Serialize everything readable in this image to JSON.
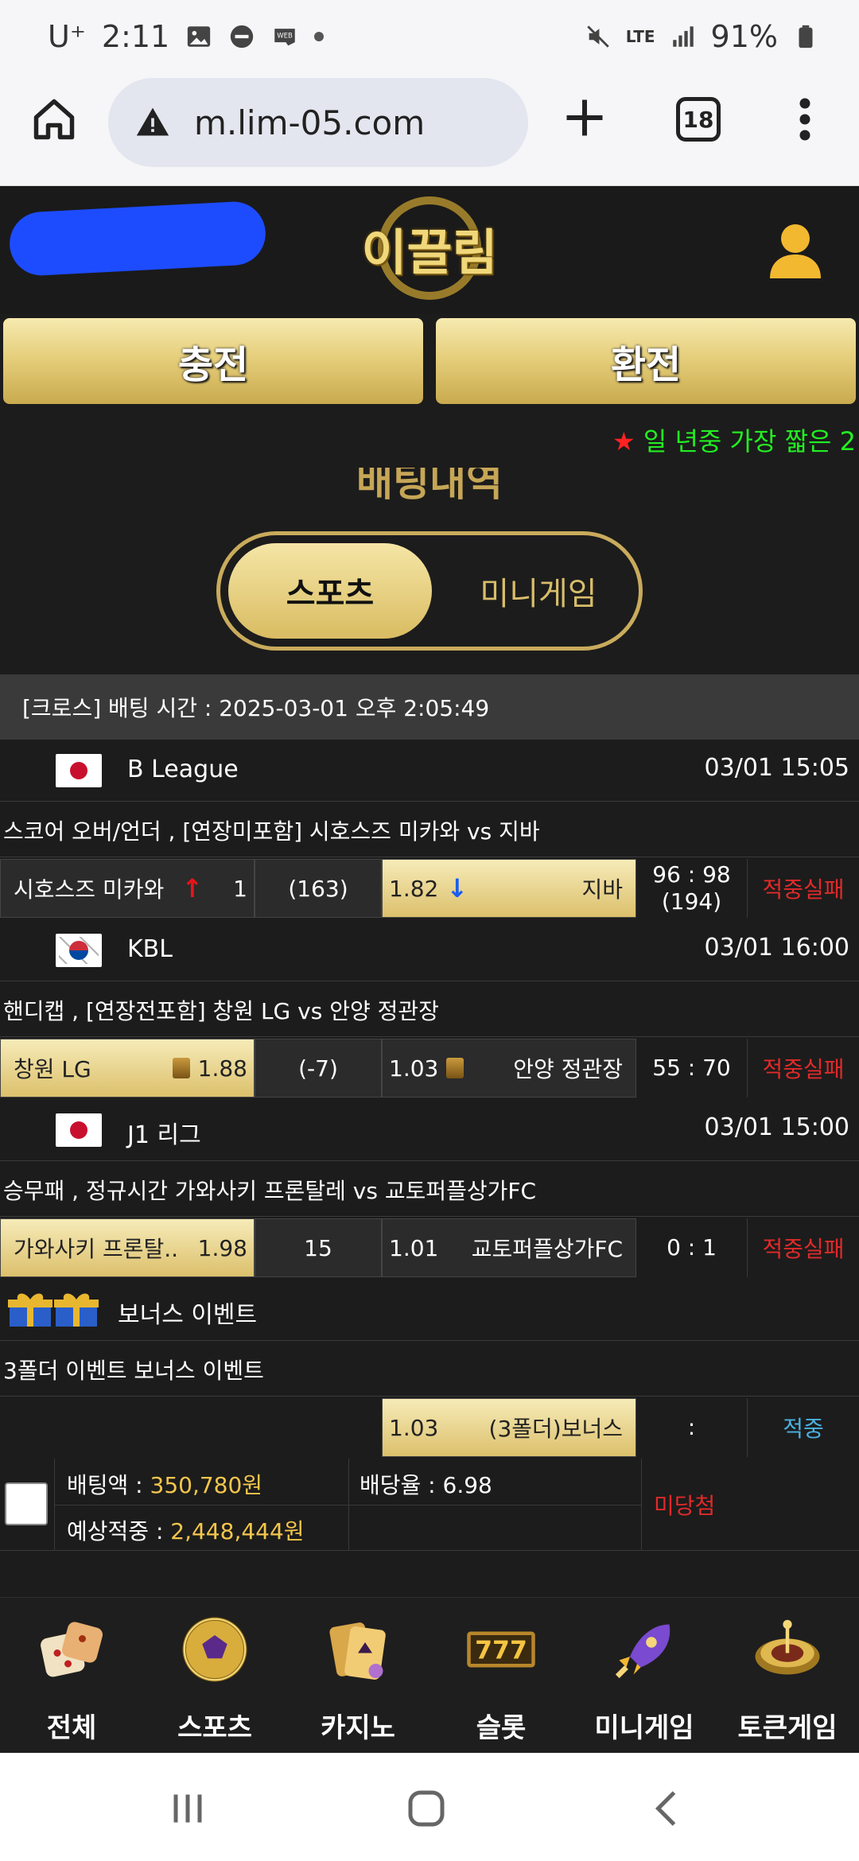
{
  "status": {
    "carrier": "U⁺",
    "time": "2:11",
    "network": "LTE",
    "battery": "91%"
  },
  "browser": {
    "url": "m.lim-05.com",
    "tab_count": "18"
  },
  "header": {
    "logo": "이끌림"
  },
  "actions": {
    "charge": "충전",
    "exchange": "환전"
  },
  "marquee": {
    "star": "★",
    "text": " 일 년중 가장 짧은 2"
  },
  "page_title": "배팅내역",
  "toggle": {
    "sports": "스포츠",
    "minigame": "미니게임"
  },
  "history": {
    "cross_header": "[크로스] 배팅 시간 : 2025-03-01 오후 2:05:49",
    "games": [
      {
        "league": "B League",
        "time": "03/01 15:05",
        "desc": "스코어 오버/언더 , [연장미포함] 시호스즈 미카와  vs  지바",
        "home": "시호스즈 미카와",
        "home_odds": "1",
        "mid": "(163)",
        "away_odds": "1.82",
        "away": "지바",
        "score": "96 : 98",
        "score2": "(194)",
        "result": "적중실패"
      },
      {
        "league": "KBL",
        "time": "03/01 16:00",
        "desc": "핸디캡 , [연장전포함] 창원 LG  vs  안양 정관장",
        "home": "창원 LG",
        "home_odds": "1.88",
        "mid": "(-7)",
        "away_odds": "1.03",
        "away": "안양 정관장",
        "score": "55 : 70",
        "result": "적중실패"
      },
      {
        "league": "J1 리그",
        "time": "03/01 15:00",
        "desc": "승무패 , 정규시간 가와사키 프론탈레  vs  교토퍼플상가FC",
        "home": "가와사키 프론탈..",
        "home_odds": "1.98",
        "mid": "15",
        "away_odds": "1.01",
        "away": "교토퍼플상가FC",
        "score": "0 : 1",
        "result": "적중실패"
      }
    ],
    "bonus": {
      "label": "보너스 이벤트",
      "desc": "3폴더 이벤트 보너스 이벤트",
      "odds": "1.03",
      "name": "(3폴더)보너스",
      "score": ":",
      "result": "적중"
    },
    "summary": {
      "bet_label": "배팅액 : ",
      "bet_value": "350,780원",
      "rate_label": "배당율 : ",
      "rate_value": "6.98",
      "expected_label": "예상적중 : ",
      "expected_value": "2,448,444원",
      "status": "미당첨"
    }
  },
  "nav": [
    {
      "label": "전체",
      "icon": "dice-icon"
    },
    {
      "label": "스포츠",
      "icon": "soccer-ball-icon"
    },
    {
      "label": "카지노",
      "icon": "cards-icon"
    },
    {
      "label": "슬롯",
      "icon": "slot-777-icon"
    },
    {
      "label": "미니게임",
      "icon": "rocket-icon"
    },
    {
      "label": "토큰게임",
      "icon": "roulette-icon"
    }
  ],
  "colors": {
    "gold": "#d9bc62",
    "fail": "#e02a2a",
    "hit": "#4ab1e0",
    "marquee": "#22ee22"
  }
}
